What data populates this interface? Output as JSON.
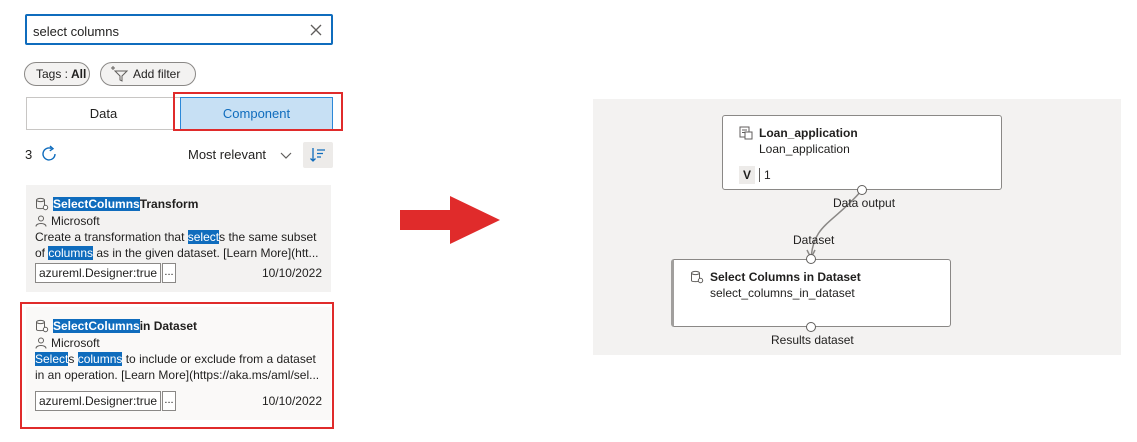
{
  "search": {
    "value": "select columns"
  },
  "filters": {
    "tags_label": "Tags :",
    "tags_value": "All",
    "add_filter_label": "Add filter"
  },
  "tabs": [
    {
      "label": "Data",
      "selected": false
    },
    {
      "label": "Component",
      "selected": true
    }
  ],
  "results": {
    "count": "3",
    "sort_label": "Most relevant",
    "cards": [
      {
        "title_parts": [
          "Select",
          " ",
          "Columns",
          " Transform"
        ],
        "author": "Microsoft",
        "desc_line1": [
          "Create a transformation that ",
          "select",
          "s the same subset"
        ],
        "desc_line2": [
          "of ",
          "columns",
          " as in the given dataset. [Learn More](htt..."
        ],
        "tag": "azureml.Designer:true",
        "more": "...",
        "date": "10/10/2022"
      },
      {
        "title_parts": [
          "Select",
          " ",
          "Columns",
          " in Dataset"
        ],
        "author": "Microsoft",
        "desc_line1": [
          "Select",
          "s ",
          "columns",
          " to include or exclude from a dataset"
        ],
        "desc_line2": [
          "in an operation. [Learn More](https://aka.ms/aml/sel..."
        ],
        "tag": "azureml.Designer:true",
        "more": "...",
        "date": "10/10/2022"
      }
    ]
  },
  "pipeline": {
    "node1": {
      "title": "Loan_application",
      "subtitle": "Loan_application",
      "version_letter": "V",
      "version_number": "1",
      "output_port": "Data output"
    },
    "node2": {
      "title": "Select Columns in Dataset",
      "subtitle": "select_columns_in_dataset",
      "input_port": "Dataset",
      "output_port": "Results dataset"
    }
  },
  "colors": {
    "accent": "#0f6cbd",
    "highlight_frame": "#e02b2b",
    "canvas_bg": "#f3f2f1"
  }
}
